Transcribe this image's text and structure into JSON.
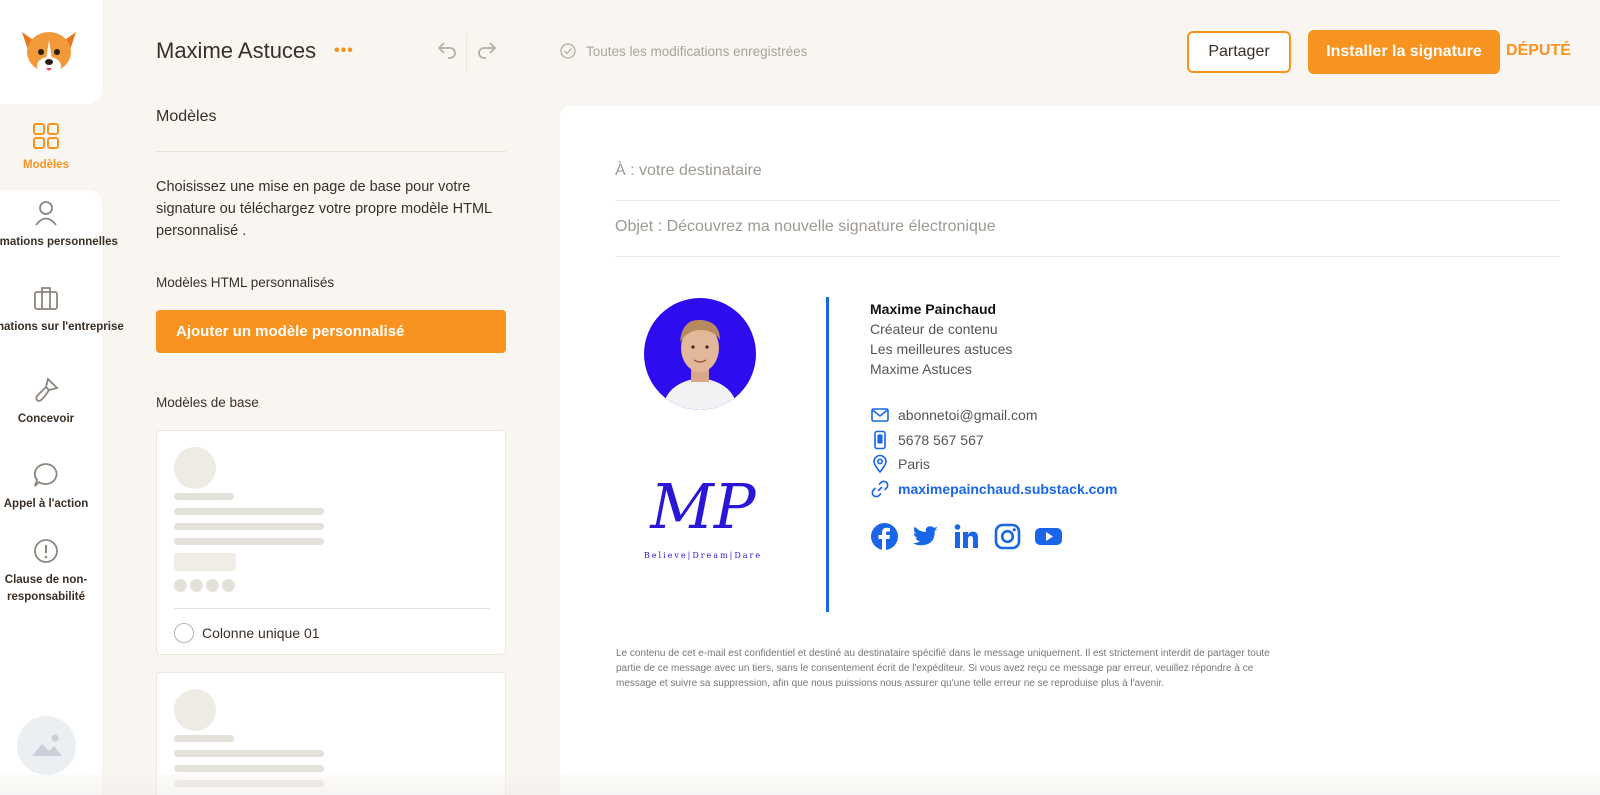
{
  "app": {
    "title": "Maxime Astuces",
    "more_icon": "more-dots-icon",
    "save_status": "Toutes les modifications enregistrées",
    "share_label": "Partager",
    "install_label": "Installer la signature",
    "depute_label": "DÉPUTÉ",
    "accent_color": "#f7931e"
  },
  "sidebar": {
    "items": [
      {
        "label": "Modèles",
        "icon": "grid-icon",
        "active": true
      },
      {
        "label": "Informations personnelles",
        "icon": "user-icon"
      },
      {
        "label": "Informations sur l'entreprise",
        "icon": "briefcase-icon"
      },
      {
        "label": "Concevoir",
        "icon": "brush-icon"
      },
      {
        "label": "Appel à l'action",
        "icon": "chat-bubble-icon"
      },
      {
        "label": "Clause de non-responsabilité",
        "icon": "alert-circle-icon"
      }
    ]
  },
  "panel": {
    "heading": "Modèles",
    "description": "Choisissez une mise en page de base pour votre signature ou téléchargez votre propre modèle HTML personnalisé .",
    "custom_heading": "Modèles HTML personnalisés",
    "add_button": "Ajouter un modèle personnalisé",
    "base_heading": "Modèles de base",
    "templates": [
      {
        "name": "Colonne unique 01"
      },
      {
        "name": ""
      }
    ]
  },
  "preview": {
    "to_placeholder": "À : votre destinataire",
    "subject": "Objet : Découvrez ma nouvelle signature électronique",
    "signature": {
      "name": "Maxime Painchaud",
      "title": "Créateur de contenu",
      "company": "Les meilleures astuces",
      "brand": "Maxime Astuces",
      "email": "abonnetoi@gmail.com",
      "phone": "5678 567 567",
      "city": "Paris",
      "website": "maximepainchaud.substack.com",
      "logo_text": "MP",
      "logo_tagline": "Believe|Dream|Dare",
      "socials": [
        "facebook-icon",
        "twitter-icon",
        "linkedin-icon",
        "instagram-icon",
        "youtube-icon"
      ],
      "link_color": "#1a66e8"
    },
    "disclaimer": "Le contenu de cet e-mail est confidentiel et destiné au destinataire spécifié dans le message uniquement. Il est strictement interdit de partager toute partie de ce message avec un tiers, sans le consentement écrit de l'expéditeur. Si vous avez reçu ce message par erreur, veuillez répondre à ce message et suivre sa suppression, afin que nous puissions nous assurer qu'une telle erreur ne se reproduise plus à l'avenir."
  }
}
